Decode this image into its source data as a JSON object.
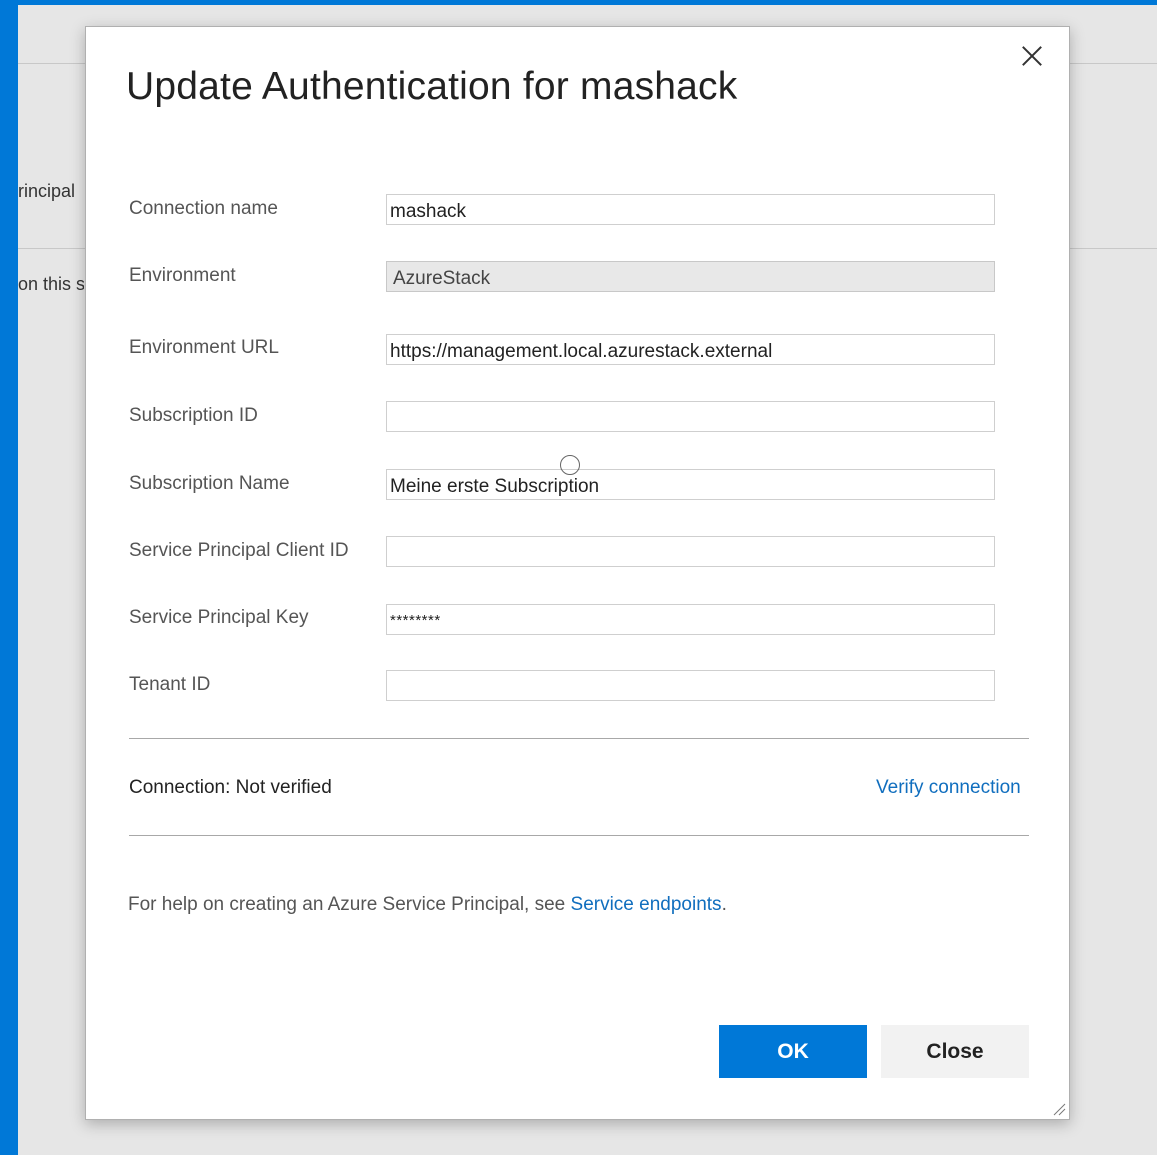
{
  "background": {
    "fragment_1": "rincipal",
    "fragment_2": "on this s"
  },
  "dialog": {
    "title": "Update Authentication for mashack",
    "fields": {
      "connection_name": {
        "label": "Connection name",
        "value": "mashack"
      },
      "environment": {
        "label": "Environment",
        "value": "AzureStack"
      },
      "environment_url": {
        "label": "Environment URL",
        "value": "https://management.local.azurestack.external"
      },
      "subscription_id": {
        "label": "Subscription ID",
        "value": ""
      },
      "subscription_name": {
        "label": "Subscription Name",
        "value": "Meine erste Subscription"
      },
      "client_id": {
        "label": "Service Principal Client ID",
        "value": ""
      },
      "key": {
        "label": "Service Principal Key",
        "value": "********"
      },
      "tenant_id": {
        "label": "Tenant ID",
        "value": ""
      }
    },
    "status": "Connection:  Not verified",
    "verify_link": "Verify connection",
    "help_text": "For help on creating an Azure Service Principal, see ",
    "help_link": "Service endpoints",
    "help_suffix": ".",
    "ok_label": "OK",
    "close_label": "Close"
  },
  "colors": {
    "accent": "#0078d7",
    "link": "#106ebe"
  }
}
